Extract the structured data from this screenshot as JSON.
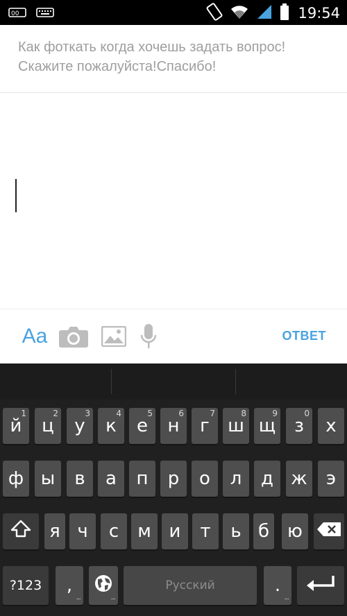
{
  "status_bar": {
    "time": "19:54",
    "icons": [
      "notification-icon",
      "keyboard-icon",
      "screen-rotation-icon",
      "wifi-icon",
      "signal-icon",
      "battery-icon"
    ]
  },
  "compose": {
    "question": "Как фоткать когда хочешь задать вопрос!Скажите пожалуйста!Спасибо!",
    "answer_text": ""
  },
  "toolbar": {
    "format_label": "Aa",
    "answer_label": "ОТВЕТ",
    "icons": [
      "camera-icon",
      "image-icon",
      "microphone-icon"
    ]
  },
  "keyboard": {
    "row1": [
      {
        "key": "й",
        "hint": "1"
      },
      {
        "key": "ц",
        "hint": "2"
      },
      {
        "key": "у",
        "hint": "3"
      },
      {
        "key": "к",
        "hint": "4"
      },
      {
        "key": "е",
        "hint": "5"
      },
      {
        "key": "н",
        "hint": "6"
      },
      {
        "key": "г",
        "hint": "7"
      },
      {
        "key": "ш",
        "hint": "8"
      },
      {
        "key": "щ",
        "hint": "9"
      },
      {
        "key": "з",
        "hint": "0"
      },
      {
        "key": "х",
        "hint": ""
      }
    ],
    "row2": [
      "ф",
      "ы",
      "в",
      "а",
      "п",
      "р",
      "о",
      "л",
      "д",
      "ж",
      "э"
    ],
    "row3": [
      "я",
      "ч",
      "с",
      "м",
      "и",
      "т",
      "ь",
      "б",
      "ю"
    ],
    "symbols_label": "?123",
    "comma_label": ",",
    "space_label": "Русский",
    "period_label": ".",
    "icons": [
      "shift-icon",
      "backspace-icon",
      "globe-icon",
      "enter-icon"
    ]
  },
  "colors": {
    "accent": "#4aa3df",
    "key_bg": "#4e4e4e",
    "keyboard_bg": "#202020"
  }
}
